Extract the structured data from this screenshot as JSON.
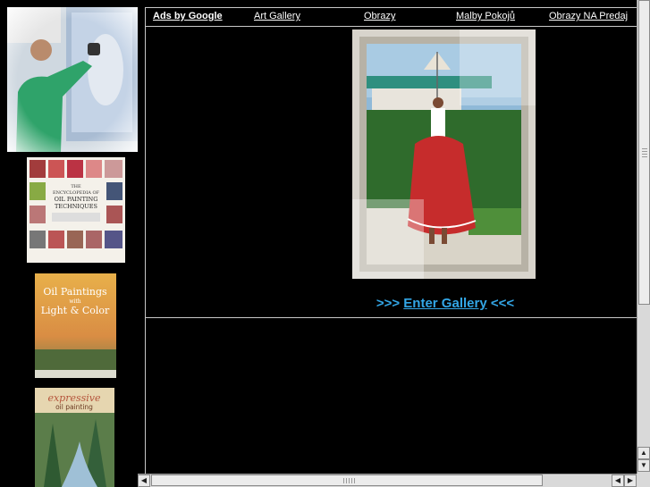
{
  "ads": {
    "label": "Ads by Google",
    "links": [
      "Art Gallery",
      "Obrazy",
      "Malby Pokojů",
      "Obrazy NA Predaj"
    ]
  },
  "gallery": {
    "prefix": ">>> ",
    "link": "Enter Gallery",
    "suffix": " <<<"
  },
  "sidebar": {
    "book1": {
      "title_line1": "THE",
      "title_line2": "ENCYCLOPEDIA OF",
      "title_line3": "OIL PAINTING",
      "title_line4": "TECHNIQUES"
    },
    "book2": {
      "title_line1": "Oil Paintings",
      "title_line2": "with",
      "title_line3": "Light & Color"
    },
    "book3": {
      "title_line1": "expressive",
      "title_line2": "oil painting"
    }
  },
  "colors": {
    "link_blue": "#33a6e6",
    "background": "#000000"
  }
}
